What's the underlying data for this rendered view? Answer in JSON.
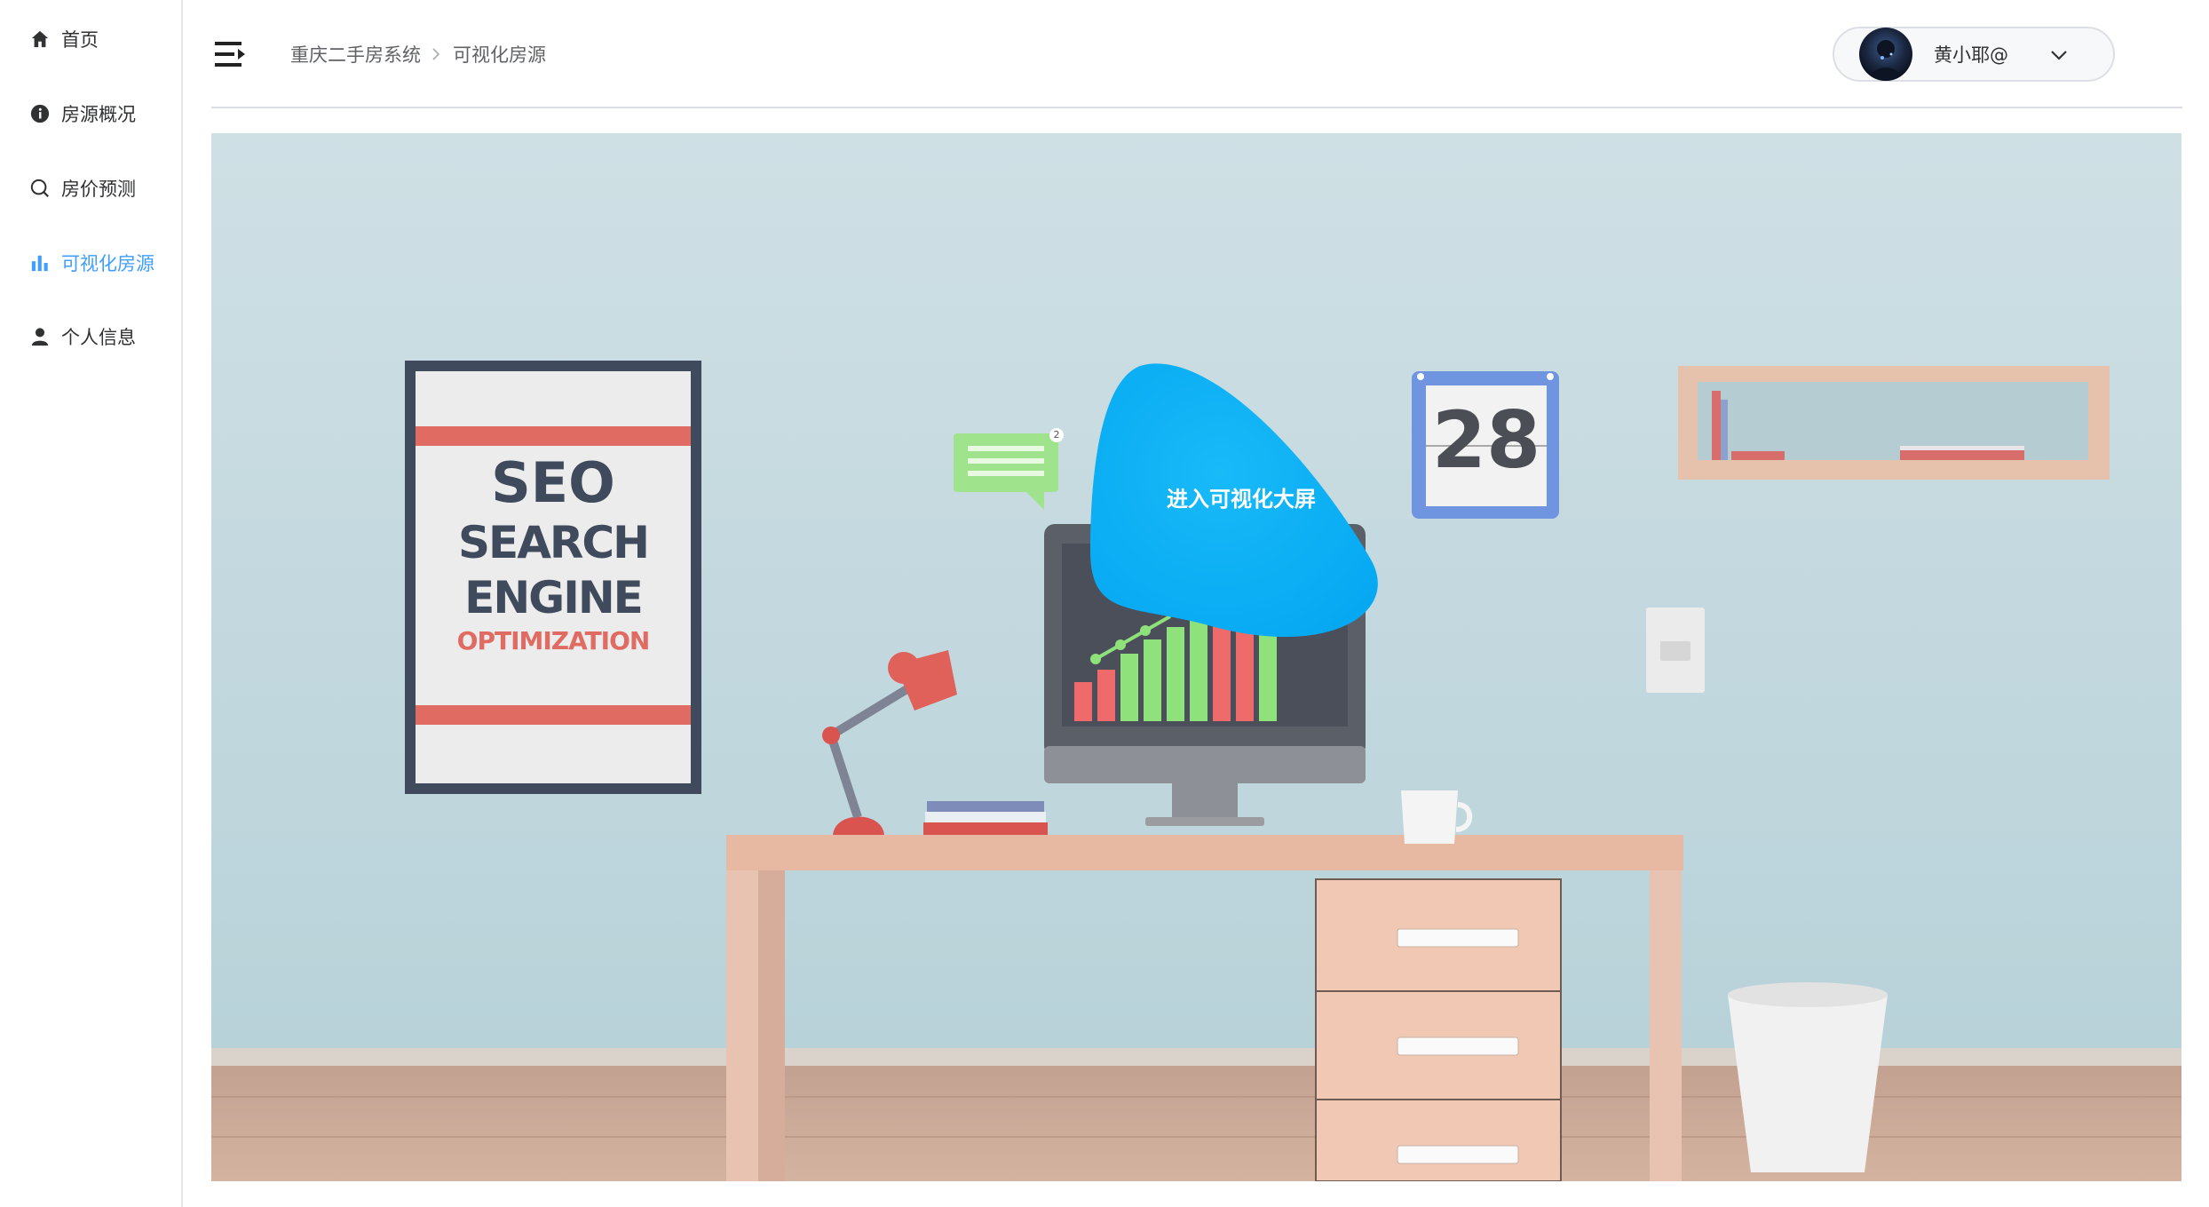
{
  "sidebar": {
    "items": [
      {
        "label": "首页",
        "icon": "home-icon",
        "active": false
      },
      {
        "label": "房源概况",
        "icon": "info-icon",
        "active": false
      },
      {
        "label": "房价预测",
        "icon": "search-icon",
        "active": false
      },
      {
        "label": "可视化房源",
        "icon": "bar-chart-icon",
        "active": true
      },
      {
        "label": "个人信息",
        "icon": "user-icon",
        "active": false
      }
    ]
  },
  "header": {
    "breadcrumb": [
      "重庆二手房系统",
      "可视化房源"
    ],
    "user": {
      "name": "黄小耶@"
    }
  },
  "banner": {
    "poster_lines": [
      "SEO",
      "SEARCH",
      "ENGINE",
      "OPTIMIZATION"
    ],
    "calendar_day": "28",
    "chat_badge": "2",
    "cta_label": "进入可视化大屏"
  },
  "colors": {
    "accent": "#409eff",
    "cta": "#0eb4f8"
  }
}
